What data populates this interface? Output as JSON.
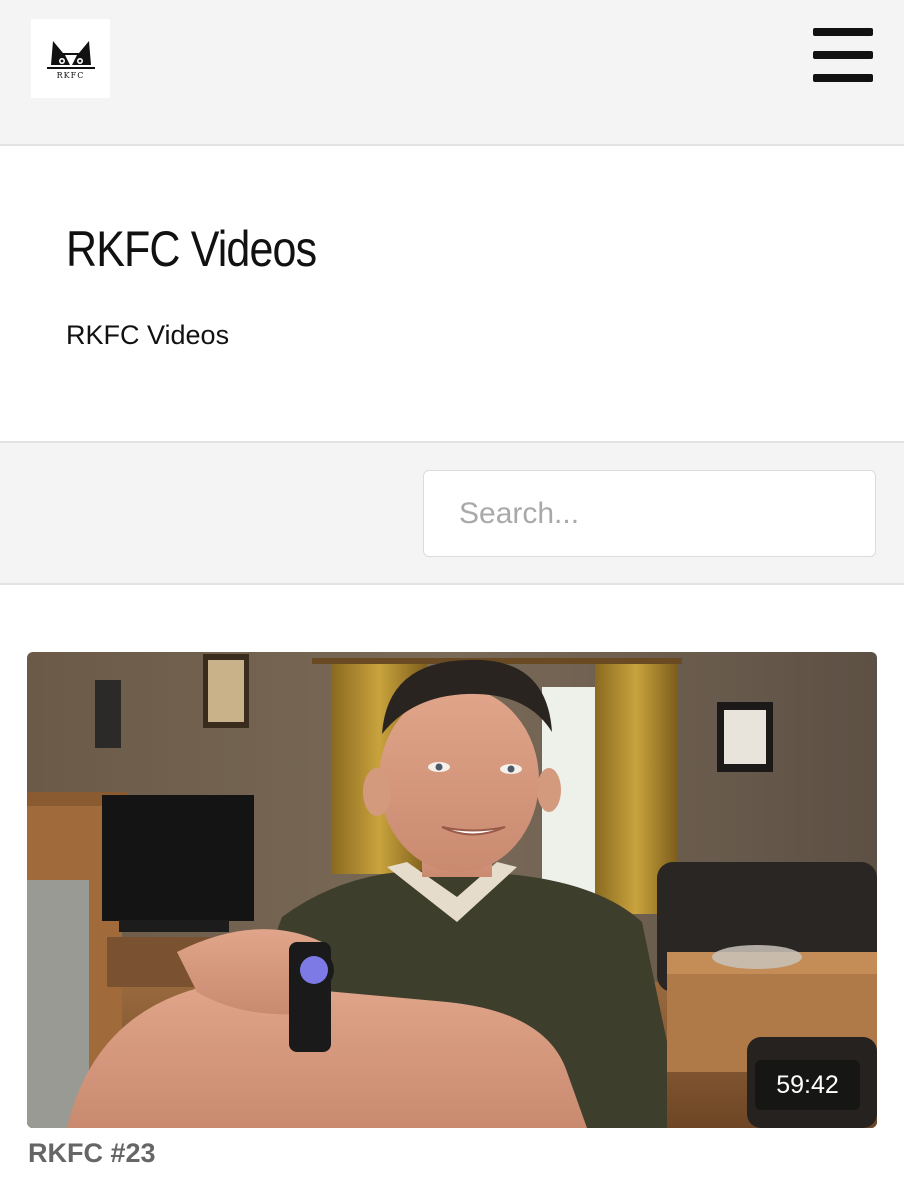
{
  "header": {
    "logo_text": "RKFC",
    "menu_icon": "hamburger-icon"
  },
  "page": {
    "title": "RKFC Videos",
    "subtitle": "RKFC Videos"
  },
  "search": {
    "placeholder": "Search...",
    "value": ""
  },
  "videos": [
    {
      "title": "RKFC #23",
      "duration": "59:42"
    }
  ]
}
